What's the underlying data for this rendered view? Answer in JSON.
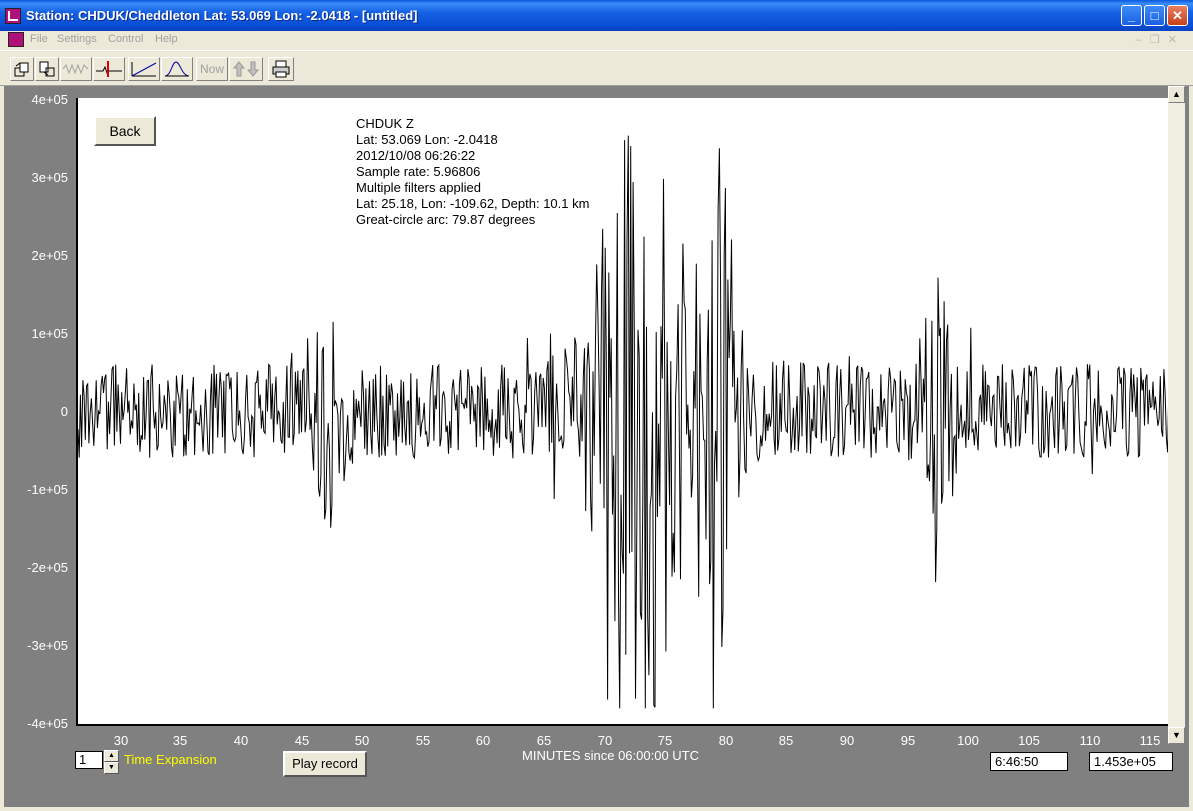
{
  "window": {
    "title": "Station: CHDUK/Cheddleton Lat: 53.069 Lon: -2.0418 - [untitled]",
    "minimize": "_",
    "maximize": "□",
    "close": "✕"
  },
  "menu": {
    "items": [
      "File",
      "Settings",
      "Control",
      "Help"
    ]
  },
  "toolbar": {
    "now_label": "Now"
  },
  "plot": {
    "back_label": "Back",
    "info_lines": [
      "CHDUK  Z",
      "Lat: 53.069 Lon: -2.0418",
      "2012/10/08 06:26:22",
      "Sample rate: 5.96806",
      "Multiple filters applied",
      "Lat: 25.18, Lon: -109.62, Depth: 10.1 km",
      "Great-circle arc: 79.87 degrees"
    ],
    "y_ticks": [
      "4e+05",
      "3e+05",
      "2e+05",
      "1e+05",
      "0",
      "-1e+05",
      "-2e+05",
      "-3e+05",
      "-4e+05"
    ],
    "x_ticks": [
      "30",
      "35",
      "40",
      "45",
      "50",
      "55",
      "60",
      "65",
      "70",
      "75",
      "80",
      "85",
      "90",
      "95",
      "100",
      "105",
      "110",
      "115"
    ],
    "x_label": "MINUTES since 06:00:00 UTC"
  },
  "controls": {
    "time_expansion_value": "1",
    "time_expansion_label": "Time Expansion",
    "play_label": "Play record",
    "time_readout": "6:46:50",
    "amplitude_readout": "1.453e+05"
  },
  "chart_data": {
    "type": "line",
    "xlabel": "MINUTES since 06:00:00 UTC",
    "ylabel": "",
    "xlim": [
      26.8,
      116.3
    ],
    "ylim": [
      -400000,
      400000
    ],
    "series": [
      {
        "values_note_omitted": true,
        "events": [
          {
            "x": 47.4,
            "peak": 150000,
            "trough": -160000
          },
          {
            "x": 72.9,
            "peak": 365000,
            "trough": -360000
          },
          {
            "x": 79.5,
            "peak": 270000,
            "trough": -315000
          },
          {
            "x": 97.3,
            "peak": 160000,
            "trough": -235000
          }
        ],
        "background_amplitude": 60000
      }
    ]
  }
}
